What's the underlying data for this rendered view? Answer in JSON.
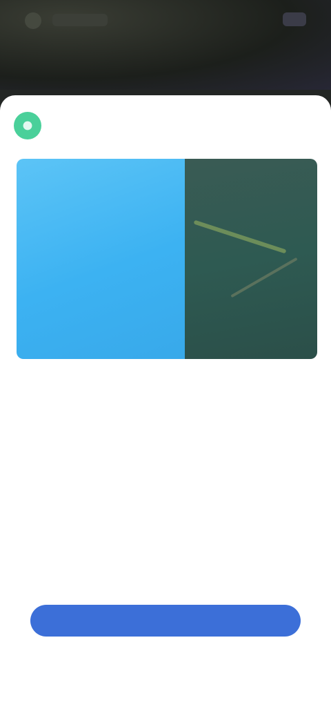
{
  "top_bar": {
    "title": "",
    "right_action": ""
  },
  "sheet": {
    "header_text": "",
    "caption": "",
    "section_label": "",
    "permissions": [
      "",
      "",
      "",
      "",
      "",
      "",
      "",
      "",
      ""
    ],
    "primary_button_label": "",
    "secondary_link_label": ""
  },
  "colors": {
    "app_icon": "#4ad09a",
    "primary_button": "#3c6fd8",
    "media_left": "#3cb2f2",
    "media_right": "#2e5a52"
  },
  "icons": {
    "app_icon": "circle-app-icon"
  }
}
